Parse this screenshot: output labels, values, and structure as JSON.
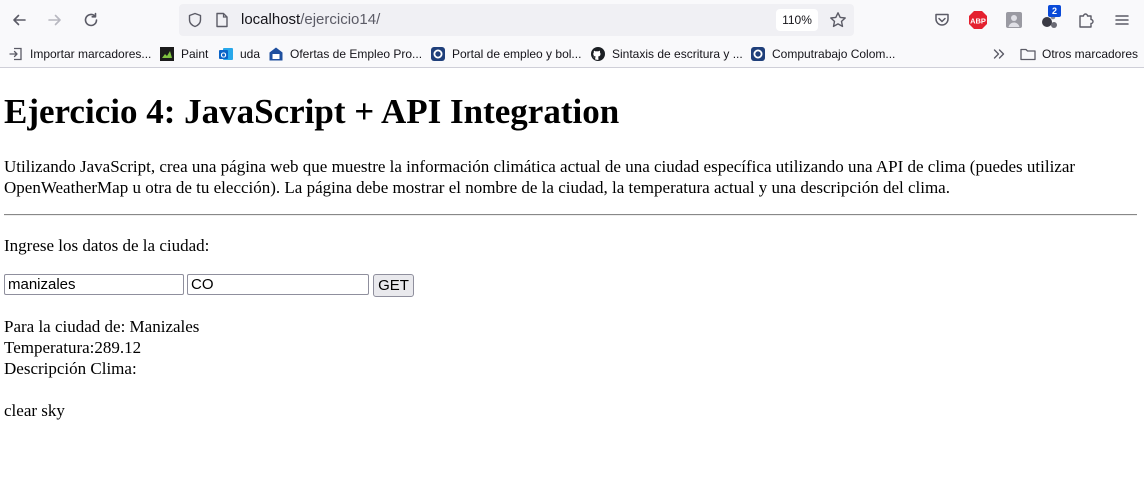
{
  "browser": {
    "url_host": "localhost",
    "url_path": "/ejercicio14/",
    "zoom": "110%",
    "notification_badge": "2",
    "bookmarks": [
      {
        "label": "Importar marcadores...",
        "icon": "import-icon"
      },
      {
        "label": "Paint",
        "icon": "paint-icon"
      },
      {
        "label": "uda",
        "icon": "outlook-icon"
      },
      {
        "label": "Ofertas de Empleo Pro...",
        "icon": "job-offers-icon"
      },
      {
        "label": "Portal de empleo y bol...",
        "icon": "job-portal-icon"
      },
      {
        "label": "Sintaxis de escritura y ...",
        "icon": "github-icon"
      },
      {
        "label": "Computrabajo Colom...",
        "icon": "computrabajo-icon"
      }
    ],
    "other_bookmarks": "Otros marcadores"
  },
  "page": {
    "title": "Ejercicio 4: JavaScript + API Integration",
    "description": "Utilizando JavaScript, crea una página web que muestre la información climática actual de una ciudad específica utilizando una API de clima (puedes utilizar OpenWeatherMap u otra de tu elección). La página debe mostrar el nombre de la ciudad, la temperatura actual y una descripción del clima.",
    "prompt": "Ingrese los datos de la ciudad:",
    "city_value": "manizales",
    "country_value": "CO",
    "get_label": "GET",
    "result_city": "Para la ciudad de: Manizales",
    "result_temp": "Temperatura:289.12",
    "result_desc_label": "Descripción Clima:",
    "result_desc": "clear sky"
  }
}
